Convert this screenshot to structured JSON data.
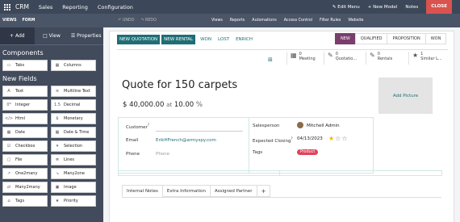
{
  "topbar": {
    "brand": "CRM",
    "nav": [
      "Sales",
      "Reporting",
      "Configuration"
    ],
    "edit_menu": "✎ Edit Menu",
    "new_model": "+ New Model",
    "notes": "Notes",
    "close": "CLOSE"
  },
  "subbar": {
    "views": "VIEWS",
    "form": "FORM",
    "undo": "↶ UNDO",
    "redo": "↷ REDO",
    "links": [
      "Views",
      "Reports",
      "Automations",
      "Access Control",
      "Filter Rules",
      "Website"
    ]
  },
  "sidebar": {
    "tabs": [
      "+ Add",
      "□ View",
      "☰ Properties"
    ],
    "components_title": "Components",
    "components": [
      {
        "icon": "▭",
        "label": "Tabs"
      },
      {
        "icon": "▦",
        "label": "Columns"
      }
    ],
    "new_fields_title": "New Fields",
    "fields": [
      {
        "icon": "A",
        "label": "Text"
      },
      {
        "icon": "≡",
        "label": "Multiline Text"
      },
      {
        "icon": "0⁹",
        "label": "Integer"
      },
      {
        "icon": "1.5",
        "label": "Decimal"
      },
      {
        "icon": "</>",
        "label": "Html"
      },
      {
        "icon": "$",
        "label": "Monetary"
      },
      {
        "icon": "▦",
        "label": "Date"
      },
      {
        "icon": "▦",
        "label": "Date & Time"
      },
      {
        "icon": "☑",
        "label": "Checkbox"
      },
      {
        "icon": "▾",
        "label": "Selection"
      },
      {
        "icon": "▢",
        "label": "File"
      },
      {
        "icon": "≣",
        "label": "Lines"
      },
      {
        "icon": "↗",
        "label": "One2many"
      },
      {
        "icon": "↘",
        "label": "Many2one"
      },
      {
        "icon": "⇄",
        "label": "Many2many"
      },
      {
        "icon": "▣",
        "label": "Image"
      },
      {
        "icon": "⌂",
        "label": "Tags"
      },
      {
        "icon": "★",
        "label": "Priority"
      }
    ]
  },
  "actions": {
    "buttons": [
      "NEW QUOTATION",
      "NEW RENTAL"
    ],
    "links": [
      "WON",
      "LOST",
      "ENRICH"
    ]
  },
  "status": [
    "NEW",
    "QUALIFIED",
    "PROPOSITION",
    "WON"
  ],
  "smart_buttons": [
    {
      "icon": "▦",
      "count": "0",
      "label": "Meeting"
    },
    {
      "icon": "✎",
      "count": "0",
      "label": "Quotatio..."
    },
    {
      "icon": "✎",
      "count": "0",
      "label": "Rentals"
    },
    {
      "icon": "★",
      "count": "1",
      "label": "Similar L..."
    }
  ],
  "record": {
    "title": "Quote for 150 carpets",
    "amount": "$ 40,000.00",
    "at": "at",
    "percent": "10.00",
    "pct_sign": "%"
  },
  "picture": "Add Picture",
  "left_fields": {
    "customer_label": "Customer",
    "customer_sup": "?",
    "email_label": "Email",
    "email_value": "ErikHFrench@armyspy.com",
    "phone_label": "Phone",
    "phone_placeholder": "Phone"
  },
  "right_fields": {
    "salesperson_label": "Salesperson",
    "salesperson_value": "Mitchell Admin",
    "closing_label": "Expected Closing",
    "closing_sup": "?",
    "closing_value": "04/13/2023",
    "tags_label": "Tags",
    "tag_value": "Product"
  },
  "stars": {
    "filled": 1,
    "total": 3
  },
  "tabs": [
    "Internal Notes",
    "Extra Information",
    "Assigned Partner",
    "+"
  ],
  "colors": {
    "topbar": "#3c4759",
    "sidebar": "#414b5c",
    "primary": "#1f6e75",
    "status_active": "#7a3e6c",
    "tag": "#e0435b",
    "close": "#d9534f"
  }
}
